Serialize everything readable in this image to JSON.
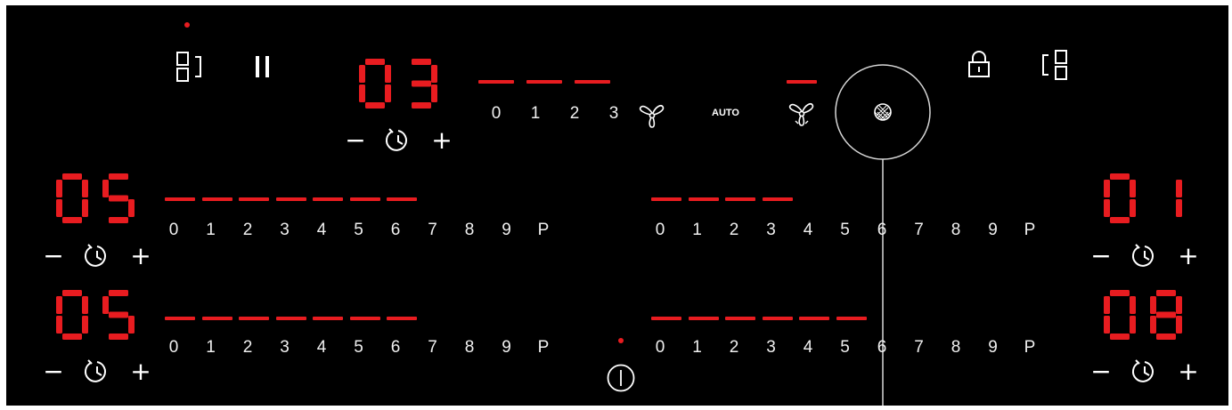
{
  "colors": {
    "background": "#000000",
    "accent": "#e81c20",
    "text": "#ffffff"
  },
  "top": {
    "bridge_icon": "zone-bridge-icon",
    "pause_icon": "pause-icon",
    "hood_timer": {
      "display": "03",
      "minus": "−",
      "plus": "+"
    },
    "fan_scale": {
      "levels": [
        "0",
        "1",
        "2",
        "3"
      ],
      "active_level": 3
    },
    "fan_icon": "fan-icon",
    "auto_label": "AUTO",
    "boost_icon": "fan-boost-icon",
    "selector_knob_icon": "grid-knob-icon",
    "lock_icon": "lock-icon",
    "zone_select_icon": "zone-select-icon"
  },
  "zones": [
    {
      "id": "front-left",
      "display": "05",
      "minus": "−",
      "plus": "+",
      "scale": [
        "0",
        "1",
        "2",
        "3",
        "4",
        "5",
        "6",
        "7",
        "8",
        "9",
        "P"
      ],
      "level": 7
    },
    {
      "id": "rear-left",
      "display": "05",
      "minus": "−",
      "plus": "+",
      "scale": [
        "0",
        "1",
        "2",
        "3",
        "4",
        "5",
        "6",
        "7",
        "8",
        "9",
        "P"
      ],
      "level": 7
    },
    {
      "id": "front-right",
      "display": "01",
      "minus": "−",
      "plus": "+",
      "scale": [
        "0",
        "1",
        "2",
        "3",
        "4",
        "5",
        "6",
        "7",
        "8",
        "9",
        "P"
      ],
      "level": 4
    },
    {
      "id": "rear-right",
      "display": "08",
      "minus": "−",
      "plus": "+",
      "scale": [
        "0",
        "1",
        "2",
        "3",
        "4",
        "5",
        "6",
        "7",
        "8",
        "9",
        "P"
      ],
      "level": 6
    }
  ],
  "power_icon": "power-icon"
}
